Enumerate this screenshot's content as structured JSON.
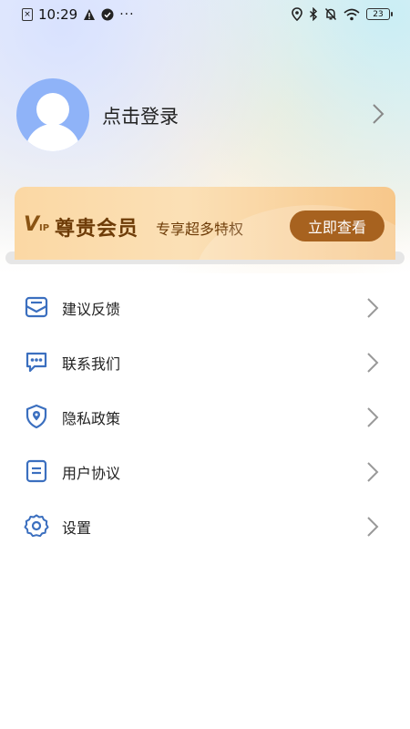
{
  "status_bar": {
    "time": "10:29",
    "sim_icon": "sim-x-icon",
    "notification_icons": [
      "warning-icon",
      "check-circle-icon",
      "more-dots-icon"
    ],
    "right_icons": [
      "location-icon",
      "bluetooth-icon",
      "mute-bell-icon",
      "wifi-icon"
    ],
    "battery": "23"
  },
  "profile": {
    "login_label": "点击登录",
    "avatar_icon": "default-avatar-icon"
  },
  "vip": {
    "logo_text": "V",
    "logo_small": "IP",
    "title": "尊贵会员",
    "subtitle": "专享超多特权",
    "button_label": "立即查看",
    "colors": {
      "card": "#fbd8a4",
      "button": "#a7621f",
      "text": "#6e3c08"
    }
  },
  "menu": {
    "items": [
      {
        "label": "建议反馈",
        "icon": "feedback-icon"
      },
      {
        "label": "联系我们",
        "icon": "chat-bubble-icon"
      },
      {
        "label": "隐私政策",
        "icon": "shield-location-icon"
      },
      {
        "label": "用户协议",
        "icon": "document-icon"
      },
      {
        "label": "设置",
        "icon": "gear-icon"
      }
    ],
    "icon_color": "#3b6fbf"
  }
}
